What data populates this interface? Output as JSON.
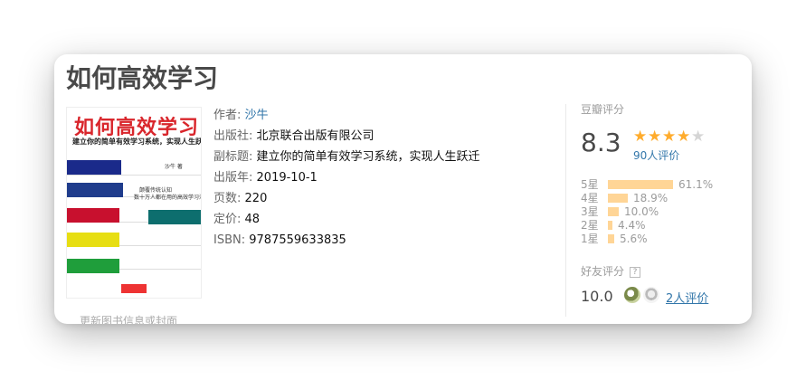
{
  "book": {
    "title": "如何高效学习",
    "update_link": "更新图书信息或封面",
    "cover": {
      "title": "如何高效学习",
      "subtitle": "建立你的简单有效学习系统，实现人生跃迁",
      "author_mark": "沙牛 著",
      "blurb_1": "颠覆传统认知",
      "blurb_2": "数十万人都在用的高效学习法",
      "colors": [
        "#1a2a8a",
        "#c8102e",
        "#e7de12",
        "#1f9e3b",
        "#0d6e6e"
      ]
    },
    "info": [
      {
        "label": "作者:",
        "value": "沙牛",
        "link": true
      },
      {
        "label": "出版社:",
        "value": "北京联合出版有限公司",
        "link": false
      },
      {
        "label": "副标题:",
        "value": "建立你的简单有效学习系统，实现人生跃迁",
        "link": false
      },
      {
        "label": "出版年:",
        "value": "2019-10-1",
        "link": false
      },
      {
        "label": "页数:",
        "value": "220",
        "link": false
      },
      {
        "label": "定价:",
        "value": "48",
        "link": false
      },
      {
        "label": "ISBN:",
        "value": "9787559633835",
        "link": false
      }
    ]
  },
  "rating": {
    "label": "豆瓣评分",
    "score": "8.3",
    "stars": 4,
    "count_text": "90人评价",
    "star_color": "#ffac2d",
    "bar_color": "#ffd596",
    "distribution": [
      {
        "star": "5星",
        "percent": "61.1%",
        "value": 61.1
      },
      {
        "star": "4星",
        "percent": "18.9%",
        "value": 18.9
      },
      {
        "star": "3星",
        "percent": "10.0%",
        "value": 10.0
      },
      {
        "star": "2星",
        "percent": "4.4%",
        "value": 4.4
      },
      {
        "star": "1星",
        "percent": "5.6%",
        "value": 5.6
      }
    ]
  },
  "friends": {
    "label": "好友评分",
    "help_icon": "?",
    "score": "10.0",
    "count_text": "2人评价"
  }
}
